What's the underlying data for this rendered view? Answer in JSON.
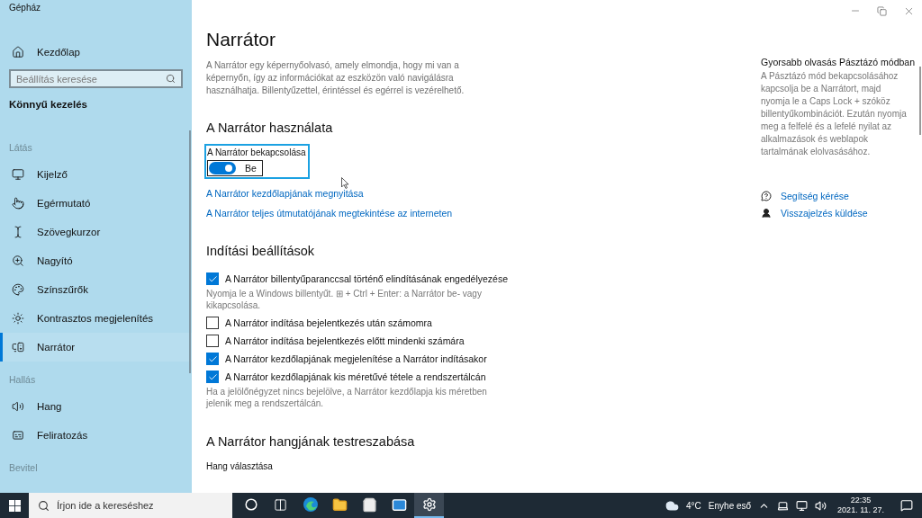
{
  "window": {
    "title": "Gépház"
  },
  "sidebar": {
    "home": "Kezdőlap",
    "search": {
      "placeholder": "Beállítás keresése"
    },
    "section": "Könnyű kezelés",
    "groups": [
      {
        "heading": "Látás",
        "items": [
          {
            "label": "Kijelző",
            "selected": false
          },
          {
            "label": "Egérmutató",
            "selected": false
          },
          {
            "label": "Szövegkurzor",
            "selected": false
          },
          {
            "label": "Nagyító",
            "selected": false
          },
          {
            "label": "Színszűrők",
            "selected": false
          },
          {
            "label": "Kontrasztos megjelenítés",
            "selected": false
          },
          {
            "label": "Narrátor",
            "selected": true
          }
        ]
      },
      {
        "heading": "Hallás",
        "items": [
          {
            "label": "Hang",
            "selected": false
          },
          {
            "label": "Feliratozás",
            "selected": false
          }
        ]
      },
      {
        "heading": "Bevitel"
      }
    ]
  },
  "main": {
    "title": "Narrátor",
    "description": "A Narrátor egy képernyőolvasó, amely elmondja, hogy mi van a képernyőn, így az információkat az eszközön való navigálásra használhatja. Billentyűzettel, érintéssel és egérrel is vezérelhető.",
    "usage": {
      "heading": "A Narrátor használata",
      "toggle": {
        "label": "A Narrátor bekapcsolása",
        "on": true,
        "state": "Be",
        "focused": true
      },
      "links": [
        "A Narrátor kezdőlapjának megnyitása",
        "A Narrátor teljes útmutatójának megtekintése az interneten"
      ]
    },
    "startup": {
      "heading": "Indítási beállítások",
      "options": [
        {
          "label": "A Narrátor billentyűparanccsal történő elindításának engedélyezése",
          "checked": true,
          "hint": "Nyomja le a Windows billentyűt. ⊞ + Ctrl + Enter: a Narrátor be- vagy kikapcsolása."
        },
        {
          "label": "A Narrátor indítása bejelentkezés után számomra",
          "checked": false
        },
        {
          "label": "A Narrátor indítása bejelentkezés előtt mindenki számára",
          "checked": false
        },
        {
          "label": "A Narrátor kezdőlapjának megjelenítése a Narrátor indításakor",
          "checked": true
        },
        {
          "label": "A Narrátor kezdőlapjának kis méretűvé tétele a rendszertálcán",
          "checked": true,
          "hint": "Ha a jelölőnégyzet nincs bejelölve, a Narrátor kezdőlapja kis méretben jelenik meg a rendszertálcán."
        }
      ]
    },
    "voice": {
      "heading": "A Narrátor hangjának testreszabása",
      "label": "Hang választása"
    }
  },
  "aside": {
    "heading": "Gyorsabb olvasás Pásztázó módban",
    "text": "A Pásztázó mód bekapcsolásához kapcsolja be a Narrátort, majd nyomja le a Caps Lock + szóköz billentyűkombinációt. Ezután nyomja meg a felfelé és a lefelé nyilat az alkalmazások és weblapok tartalmának elolvasásához.",
    "links": [
      "Segítség kérése",
      "Visszajelzés küldése"
    ]
  },
  "taskbar": {
    "search": {
      "placeholder": "Írjon ide a kereséshez"
    },
    "apps": [
      {
        "selected": false
      },
      {
        "selected": false
      },
      {
        "selected": false
      },
      {
        "selected": false
      },
      {
        "selected": false
      },
      {
        "selected": false
      },
      {
        "selected": true
      }
    ],
    "weather": {
      "temperature": "4°C",
      "condition": "Enyhe eső"
    },
    "time": "22:35",
    "date": "2021. 11. 27."
  }
}
